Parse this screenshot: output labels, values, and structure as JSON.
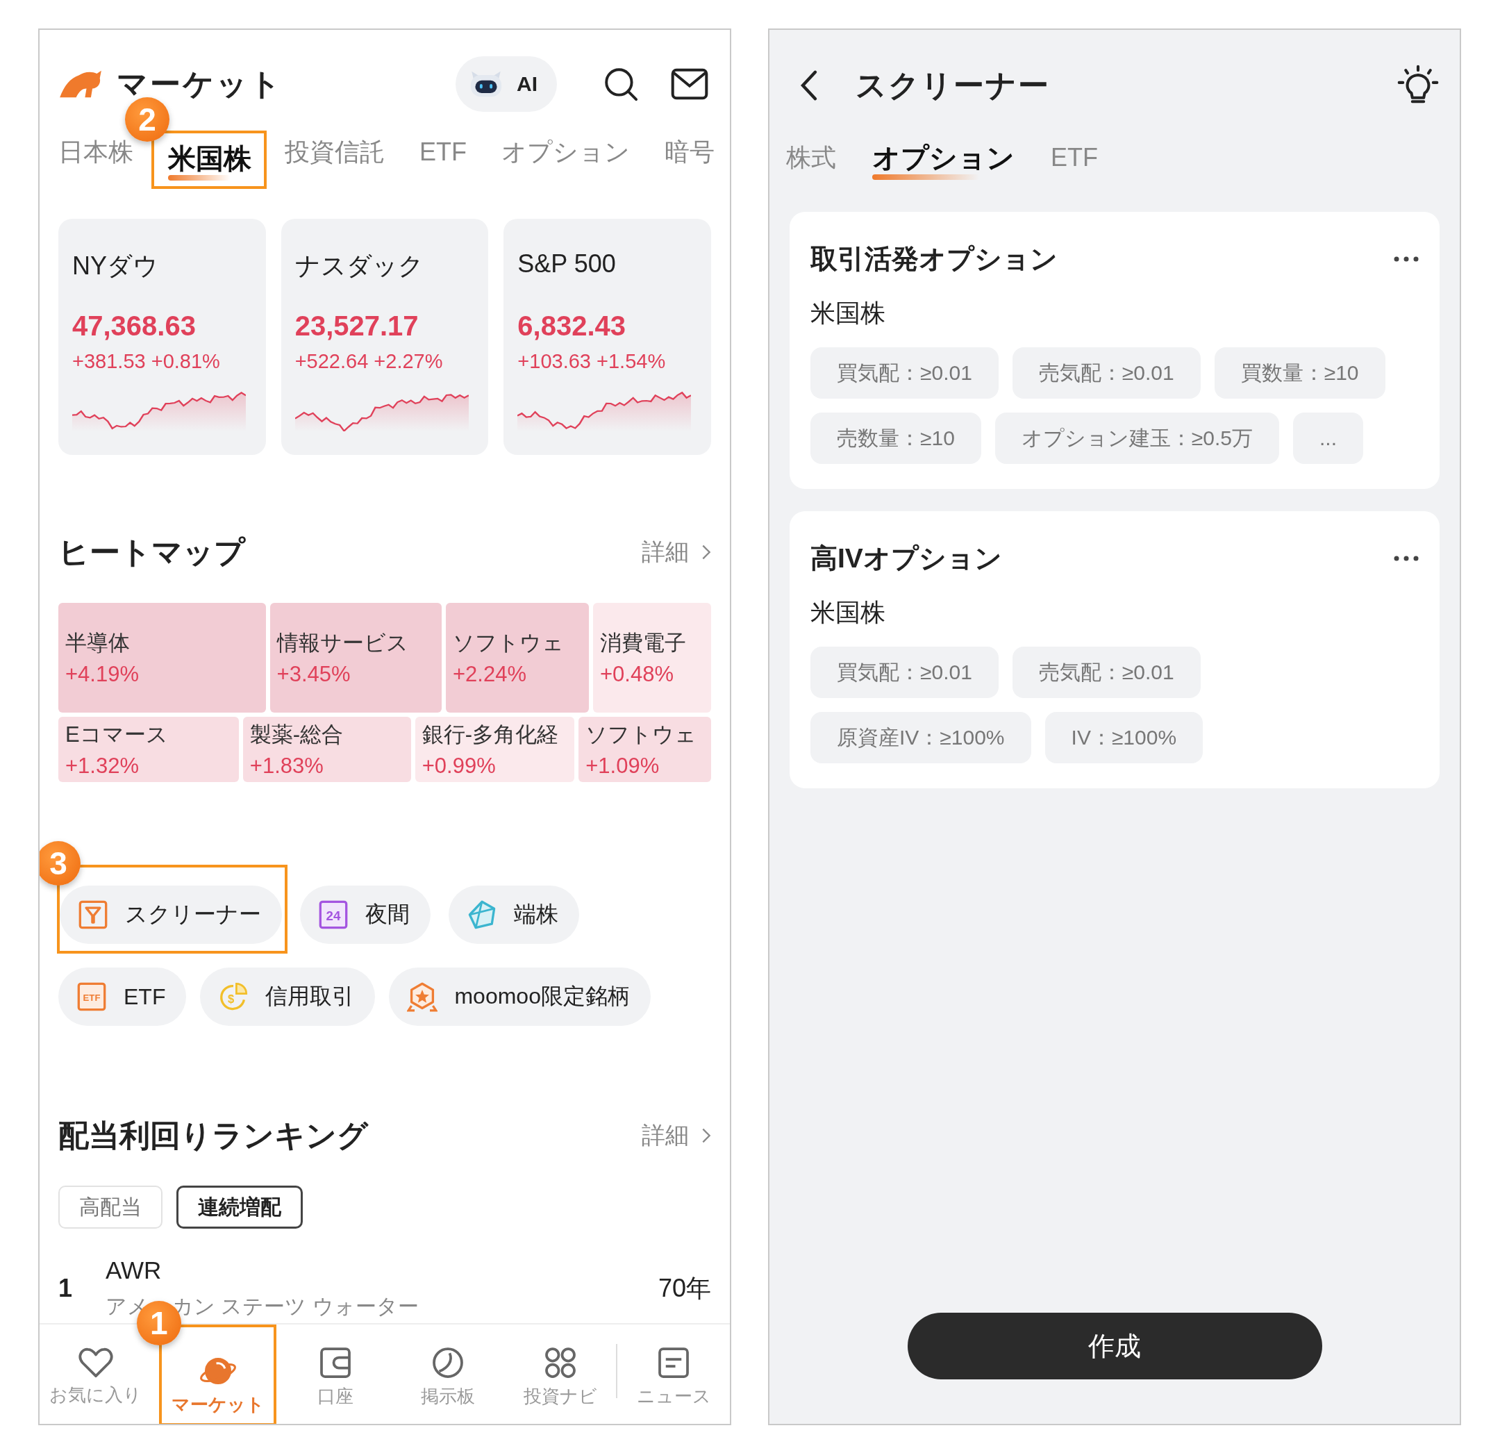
{
  "market": {
    "header": {
      "title": "マーケット",
      "ai_label": "AI"
    },
    "tabs": [
      {
        "label": "日本株",
        "selected": false
      },
      {
        "label": "米国株",
        "selected": true,
        "callout": "2"
      },
      {
        "label": "投資信託",
        "selected": false
      },
      {
        "label": "ETF",
        "selected": false
      },
      {
        "label": "オプション",
        "selected": false
      },
      {
        "label": "暗号",
        "selected": false
      }
    ],
    "indices": [
      {
        "name": "NYダウ",
        "value": "47,368.63",
        "change": "+381.53 +0.81%"
      },
      {
        "name": "ナスダック",
        "value": "23,527.17",
        "change": "+522.64 +2.27%"
      },
      {
        "name": "S&P 500",
        "value": "6,832.43",
        "change": "+103.63 +1.54%"
      }
    ],
    "heatmap": {
      "title": "ヒートマップ",
      "more": "詳細",
      "rows": [
        [
          {
            "name": "半導体",
            "change": "+4.19%",
            "color": "#f2ccd4"
          },
          {
            "name": "情報サービス",
            "change": "+3.45%",
            "color": "#f2ccd4"
          },
          {
            "name": "ソフトウェ",
            "change": "+2.24%",
            "color": "#f2ccd4"
          },
          {
            "name": "消費電子",
            "change": "+0.48%",
            "color": "#fbe9ec"
          }
        ],
        [
          {
            "name": "Eコマース",
            "change": "+1.32%",
            "color": "#f8dde2"
          },
          {
            "name": "製薬-総合",
            "change": "+1.83%",
            "color": "#f8dde2"
          },
          {
            "name": "銀行-多角化経",
            "change": "+0.99%",
            "color": "#fbe9ec"
          },
          {
            "name": "ソフトウェ",
            "change": "+1.09%",
            "color": "#f8dde2"
          }
        ]
      ]
    },
    "shortcuts": [
      {
        "kind": "screener",
        "label": "スクリーナー",
        "callout": "3"
      },
      {
        "kind": "night",
        "label": "夜間",
        "icon_text": "24"
      },
      {
        "kind": "odd_lot",
        "label": "端株"
      },
      {
        "kind": "etf",
        "label": "ETF",
        "icon_text": "ETF"
      },
      {
        "kind": "margin",
        "label": "信用取引",
        "icon_text": "$"
      },
      {
        "kind": "exclusive",
        "label": "moomoo限定銘柄"
      }
    ],
    "dividend": {
      "title": "配当利回りランキング",
      "more": "詳細",
      "filters": [
        {
          "label": "高配当",
          "selected": false
        },
        {
          "label": "連続増配",
          "selected": true
        }
      ],
      "rows": [
        {
          "rank": "1",
          "symbol": "AWR",
          "name_start": "アメ",
          "name_end": "カン ステーツ ウォーター",
          "value": "70年"
        }
      ]
    },
    "nav": [
      {
        "kind": "heart",
        "label": "お気に入り",
        "selected": false
      },
      {
        "kind": "planet",
        "label": "マーケット",
        "selected": true,
        "callout": "1"
      },
      {
        "kind": "wallet",
        "label": "口座",
        "selected": false
      },
      {
        "kind": "board",
        "label": "掲示板",
        "selected": false
      },
      {
        "kind": "grid",
        "label": "投資ナビ",
        "selected": false
      },
      {
        "kind": "news",
        "label": "ニュース",
        "selected": false
      }
    ]
  },
  "screener": {
    "title": "スクリーナー",
    "tabs": [
      {
        "label": "株式",
        "selected": false
      },
      {
        "label": "オプション",
        "selected": true
      },
      {
        "label": "ETF",
        "selected": false
      }
    ],
    "cards": [
      {
        "title": "取引活発オプション",
        "market": "米国株",
        "filters": [
          "買気配：≥0.01",
          "売気配：≥0.01",
          "買数量：≥10",
          "売数量：≥10",
          "オプション建玉：≥0.5万",
          "..."
        ]
      },
      {
        "title": "高IVオプション",
        "market": "米国株",
        "filters": [
          "買気配：≥0.01",
          "売気配：≥0.01",
          "原資産IV：≥100%",
          "IV：≥100%"
        ]
      }
    ],
    "create_button": "作成"
  }
}
